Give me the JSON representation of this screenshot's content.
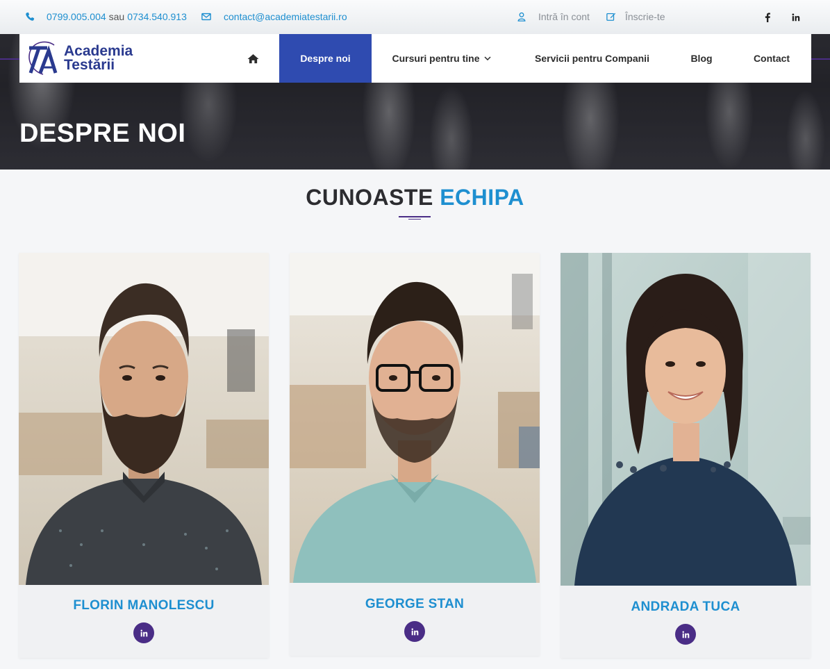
{
  "topbar": {
    "phone1": "0799.005.004",
    "phone_separator": "sau",
    "phone2": "0734.540.913",
    "email": "contact@academiatestarii.ro",
    "login": "Intră în cont",
    "register": "Înscrie-te",
    "social": [
      "facebook-icon",
      "linkedin-icon"
    ]
  },
  "logo": {
    "line1": "Academia",
    "line2": "Testării"
  },
  "nav": {
    "home_icon": "home-icon",
    "items": [
      {
        "label": "Despre noi",
        "active": true
      },
      {
        "label": "Cursuri pentru tine",
        "dropdown": true
      },
      {
        "label": "Servicii pentru Companii"
      },
      {
        "label": "Blog"
      },
      {
        "label": "Contact"
      }
    ]
  },
  "page_title": "DESPRE NOI",
  "section": {
    "heading_dark": "CUNOASTE",
    "heading_blue": "ECHIPA"
  },
  "team": [
    {
      "name": "FLORIN MANOLESCU",
      "social": "linkedin-icon"
    },
    {
      "name": "GEORGE STAN",
      "social": "linkedin-icon"
    },
    {
      "name": "ANDRADA TUCA",
      "social": "linkedin-icon"
    }
  ],
  "colors": {
    "brand_blue": "#1e8fd0",
    "nav_active": "#2f4bb0",
    "accent_purple": "#4a2d86",
    "text_dark": "#2c2c30"
  }
}
